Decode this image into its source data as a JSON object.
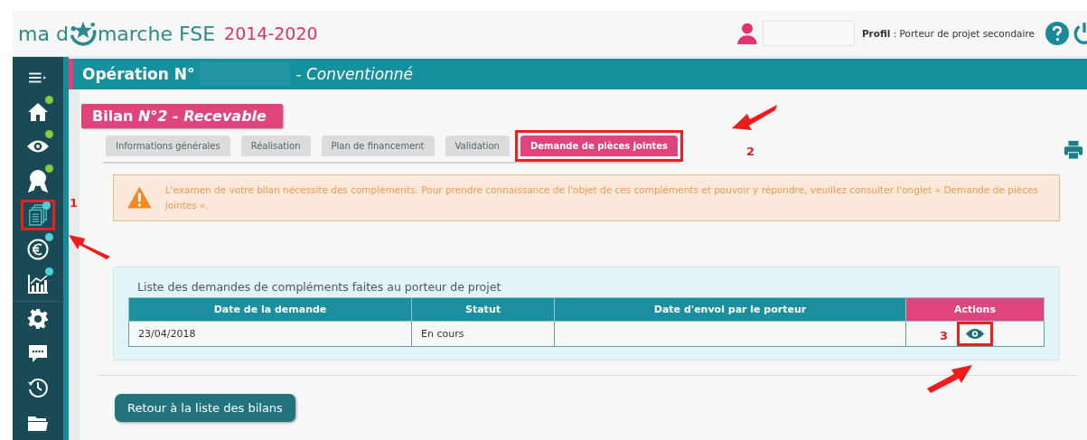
{
  "header": {
    "logo_before": "ma d",
    "logo_after": "marche FSE",
    "logo_years": "2014-2020",
    "profile": "**Profil** : Porteur de projet secondaire"
  },
  "sidebar": {
    "items": [
      {
        "kind": "menu"
      },
      {
        "kind": "home",
        "color": "#8dc63f"
      },
      {
        "kind": "eye",
        "color": "#8dc63f"
      },
      {
        "kind": "award",
        "color": "#8dc63f"
      },
      {
        "kind": "documents",
        "color": "#4fd1d9",
        "annotated": true
      },
      {
        "kind": "euro",
        "color": "#4fd1d9"
      },
      {
        "kind": "chart",
        "color": "#4fd1d9"
      },
      {
        "kind": "gear"
      },
      {
        "kind": "chat"
      },
      {
        "kind": "history"
      },
      {
        "kind": "folder"
      }
    ]
  },
  "operation": {
    "label": "Opération N°",
    "status": "- Conventionné"
  },
  "bilan": {
    "title": "Bilan *N°2 - Recevable*"
  },
  "tabs": [
    {
      "label": "Informations générales",
      "selected": false,
      "annotated": false
    },
    {
      "label": "Réalisation",
      "selected": false,
      "annotated": false
    },
    {
      "label": "Plan de financement",
      "selected": false,
      "annotated": false
    },
    {
      "label": "Validation",
      "selected": false,
      "annotated": false
    },
    {
      "label": "Demande de pièces jointes",
      "selected": true,
      "annotated": true
    }
  ],
  "alert": {
    "text": "L'examen de votre bilan nécessite des compléments. Pour prendre connaissance de l'objet de ces compléments et pouvoir y répondre, veuillez consulter l'onglet « Demande de pièces jointes »."
  },
  "requests": {
    "title": "Liste des demandes de compléments faites au porteur de projet",
    "columns": [
      "Date de la demande",
      "Statut",
      "Date d'envoi par le porteur",
      "Actions"
    ],
    "rows": [
      {
        "date": "23/04/2018",
        "status": "En cours",
        "sent": "",
        "action_annotated": true
      }
    ]
  },
  "back_button": "Retour à la liste des bilans",
  "callouts": [
    "1",
    "2",
    "3"
  ]
}
